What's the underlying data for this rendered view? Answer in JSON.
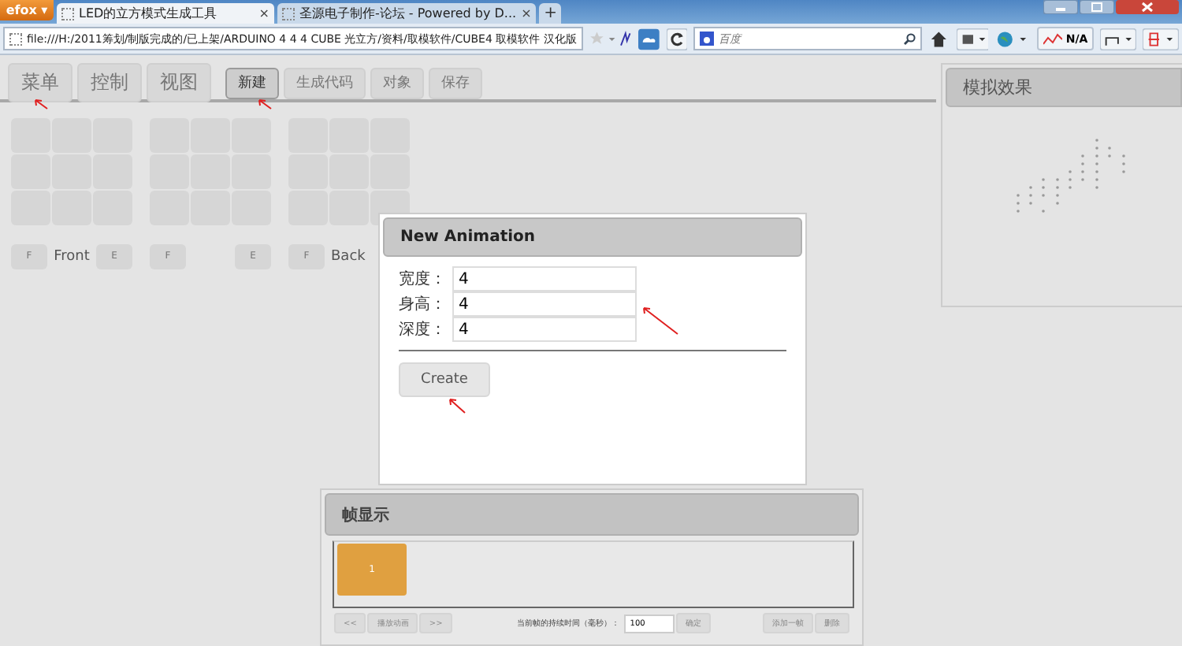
{
  "browser": {
    "menu_button": "efox ▾",
    "tabs": [
      {
        "title": "LED的立方模式生成工具",
        "close": "×",
        "selected": true
      },
      {
        "title": "圣源电子制作-论坛 - Powered by D...",
        "close": "×",
        "selected": false
      }
    ],
    "new_tab": "+",
    "url": "file:///H:/2011筹划/制版完成的/已上架/ARDUINO 4 4 4 CUBE 光立方/资料/取模软件/CUBE4 取模软件 汉化版",
    "search_placeholder": "百度",
    "addon_label": "N/A"
  },
  "toolbar": {
    "main_buttons": [
      {
        "label": "菜单"
      },
      {
        "label": "控制"
      },
      {
        "label": "视图"
      }
    ],
    "edit_buttons": [
      {
        "label": "新建",
        "selected": true
      },
      {
        "label": "生成代码",
        "selected": false
      },
      {
        "label": "对象",
        "selected": false
      },
      {
        "label": "保存",
        "selected": false
      }
    ]
  },
  "layers": [
    {
      "front_button": "F",
      "caption": "Front",
      "end_button": "E"
    },
    {
      "front_button": "F",
      "end_button": "E"
    },
    {
      "front_button": "F",
      "caption": "Back"
    }
  ],
  "simulation": {
    "title": "模拟效果"
  },
  "dialog": {
    "title": "New Animation",
    "fields": [
      {
        "label": "宽度：",
        "value": "4"
      },
      {
        "label": "身高：",
        "value": "4"
      },
      {
        "label": "深度：",
        "value": "4"
      }
    ],
    "button": "Create"
  },
  "frames_panel": {
    "title": "帧显示",
    "frames": [
      {
        "label": "1",
        "selected": true
      }
    ],
    "prev": "<<",
    "play": "播放动画",
    "next": ">>",
    "duration_label": "当前帧的持续时间（毫秒）：",
    "duration": "100",
    "confirm": "确定",
    "add": "添加一帧",
    "delete": "删除"
  }
}
